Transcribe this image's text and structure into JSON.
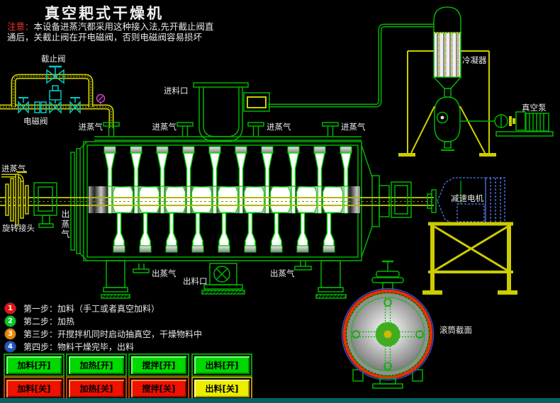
{
  "title": "真空耙式干燥机",
  "warning": {
    "tag": "注意：",
    "line1": "本设备进蒸汽都采用这种接入法,先开截止阀直",
    "line2": "通后，关截止阀在开电磁阀，否则电磁阀容易损坏"
  },
  "labels": {
    "stop_valve": "截止阀",
    "solenoid_valve": "电磁阀",
    "feed_port": "进料口",
    "steam_in": "进蒸气",
    "steam_out": "出蒸气",
    "rotary_joint": "旋转接头",
    "condenser": "冷凝器",
    "vacuum_pump": "真空泵",
    "gear_motor": "减速电机",
    "discharge_port": "出料口",
    "drum_section": "滚筒截面"
  },
  "steps": [
    {
      "num": "1",
      "text": "第一步：加料（手工或者真空加料）",
      "color": "#ee1111"
    },
    {
      "num": "2",
      "text": "第二步：加热",
      "color": "#00cc22"
    },
    {
      "num": "3",
      "text": "第三步：开搅拌机同时启动抽真空，干燥物料中",
      "color": "#ee8800"
    },
    {
      "num": "4",
      "text": "第四步：物料干燥完毕，出料",
      "color": "#2255cc"
    }
  ],
  "buttons": {
    "row1": [
      {
        "label": "加料[开]",
        "style": "green"
      },
      {
        "label": "加热[开]",
        "style": "green"
      },
      {
        "label": "搅拌[开]",
        "style": "green"
      },
      {
        "label": "出料[开]",
        "style": "green"
      }
    ],
    "row2": [
      {
        "label": "加料[关]",
        "style": "red"
      },
      {
        "label": "加热[关]",
        "style": "red"
      },
      {
        "label": "搅拌[关]",
        "style": "red"
      },
      {
        "label": "出料[关]",
        "style": "yellow"
      }
    ]
  },
  "colors": {
    "pipe_yellow": "#cccc00",
    "valve_cyan": "#00c8c8",
    "machine_green": "#00b400",
    "alarm_red": "#ff3333",
    "gauge_magenta": "#cc44cc",
    "motor_blue": "#5577ee",
    "button_green": "#00d800",
    "button_red": "#ee1200",
    "button_yellow": "#eded00"
  }
}
